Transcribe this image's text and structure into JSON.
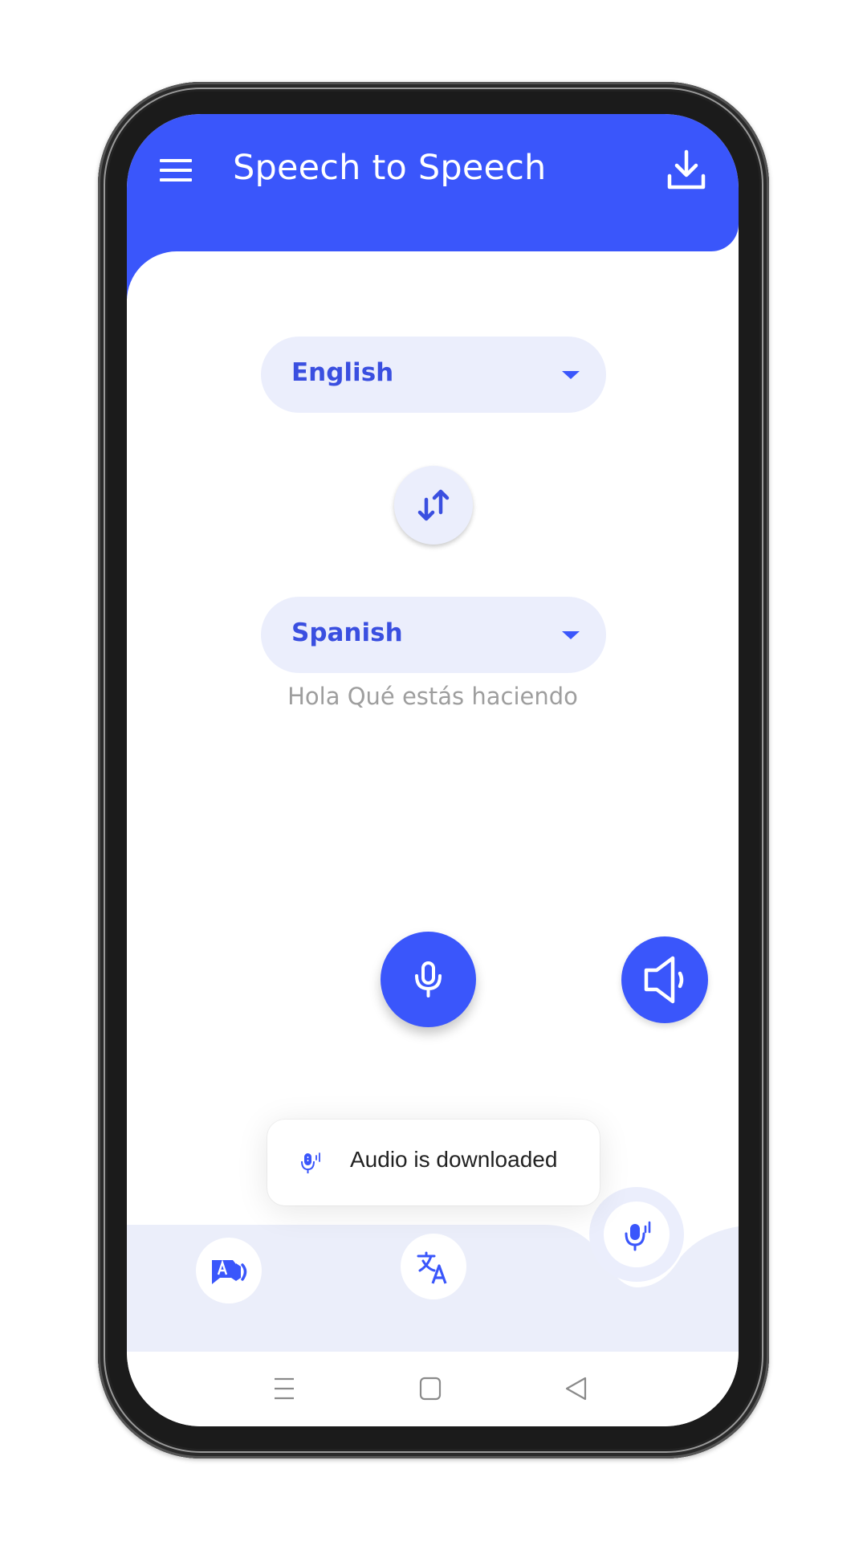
{
  "app": {
    "title": "Speech to Speech",
    "accent_color": "#3a56fb",
    "soft_color": "#ebeefc"
  },
  "header": {
    "menu_icon": "hamburger-menu-icon",
    "download_icon": "download-icon"
  },
  "source_language": {
    "selected": "English",
    "icon": "dropdown-caret-icon"
  },
  "swap_button": {
    "icon": "swap-vertical-arrows-icon"
  },
  "target_language": {
    "selected": "Spanish",
    "icon": "dropdown-caret-icon"
  },
  "translation": {
    "text": "Hola Qué estás haciendo"
  },
  "actions": {
    "mic_icon": "microphone-icon",
    "speaker_icon": "speaker-icon"
  },
  "toast": {
    "icon": "voice-mic-icon",
    "message": "Audio is downloaded"
  },
  "bottom_nav": {
    "items": [
      {
        "name": "text-to-speech",
        "icon": "text-to-speech-icon",
        "active": false
      },
      {
        "name": "translate",
        "icon": "translate-icon",
        "active": false
      },
      {
        "name": "speech-to-speech",
        "icon": "voice-mic-icon",
        "active": true
      }
    ]
  },
  "system_nav": {
    "items": [
      "recents-icon",
      "home-icon",
      "back-icon"
    ]
  }
}
